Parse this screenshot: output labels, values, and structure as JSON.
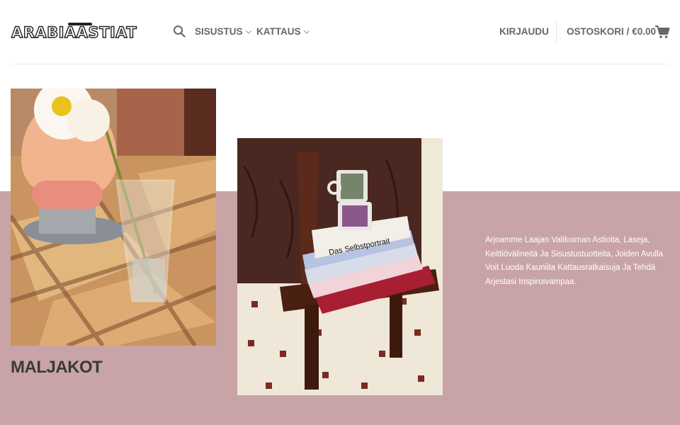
{
  "header": {
    "logo_text": "ARABIAASTIAT",
    "nav": [
      {
        "label": "SISUSTUS"
      },
      {
        "label": "KATTAUS"
      }
    ],
    "login_label": "KIRJAUDU",
    "cart_label": "OSTOSKORI /",
    "cart_total": "€0.00"
  },
  "main": {
    "category_title": "MALJAKOT",
    "description": "Arjoamme Laajan Valikoiman Astioita, Laseja, Keittiövälineitä Ja Sisustustuotteita, Joiden Avulla Voit Luoda Kauniita Kattausratkaisuja Ja Tehdä Arjestasi Inspiroivampaa."
  },
  "colors": {
    "band": "#c8a4a6",
    "text_nav": "#666666",
    "title": "#3a3a3a"
  },
  "icons": {
    "search": "search-icon",
    "chevron": "chevron-down-icon",
    "cart": "shopping-cart-icon"
  }
}
